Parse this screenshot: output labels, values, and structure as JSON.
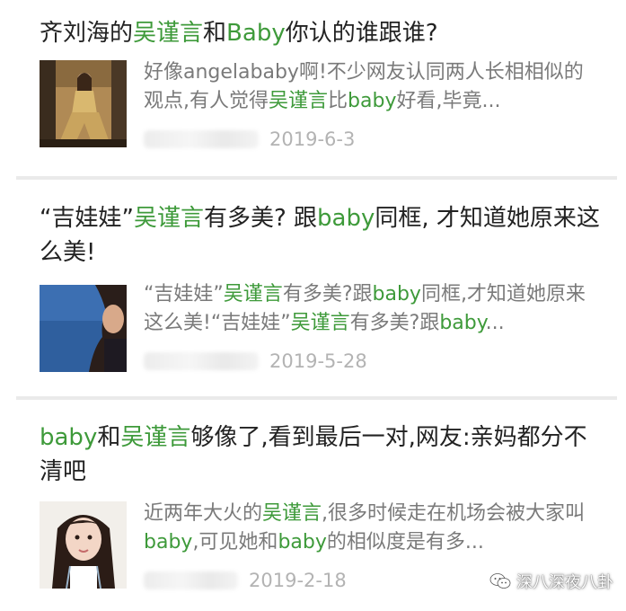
{
  "articles": [
    {
      "title": [
        {
          "t": "齐刘海的",
          "h": false
        },
        {
          "t": "吴谨言",
          "h": true
        },
        {
          "t": "和",
          "h": false
        },
        {
          "t": "Baby",
          "h": true
        },
        {
          "t": "你认的谁跟谁?",
          "h": false
        }
      ],
      "snippet": [
        {
          "t": "好像angelababy啊!不少网友认同两人长相相似的观点,有人觉得",
          "h": false
        },
        {
          "t": "吴谨言",
          "h": true
        },
        {
          "t": "比",
          "h": false
        },
        {
          "t": "baby",
          "h": true
        },
        {
          "t": "好看,毕竟...",
          "h": false
        }
      ],
      "date": "2019-6-3",
      "thumb_icon": "woman-sitting-photo"
    },
    {
      "title": [
        {
          "t": "“吉娃娃”",
          "h": false
        },
        {
          "t": "吴谨言",
          "h": true
        },
        {
          "t": "有多美? 跟",
          "h": false
        },
        {
          "t": "baby",
          "h": true
        },
        {
          "t": "同框, 才知道她原来这么美!",
          "h": false
        }
      ],
      "snippet": [
        {
          "t": "“吉娃娃”",
          "h": false
        },
        {
          "t": "吴谨言",
          "h": true
        },
        {
          "t": "有多美?跟",
          "h": false
        },
        {
          "t": "baby",
          "h": true
        },
        {
          "t": "同框,才知道她原来这么美!“吉娃娃”",
          "h": false
        },
        {
          "t": "吴谨言",
          "h": true
        },
        {
          "t": "有多美?跟",
          "h": false
        },
        {
          "t": "baby",
          "h": true
        },
        {
          "t": "...",
          "h": false
        }
      ],
      "date": "2019-5-28",
      "thumb_icon": "man-portrait-photo"
    },
    {
      "title": [
        {
          "t": "baby",
          "h": true
        },
        {
          "t": "和",
          "h": false
        },
        {
          "t": "吴谨言",
          "h": true
        },
        {
          "t": "够像了,看到最后一对,网友:亲妈都分不清吧",
          "h": false
        }
      ],
      "snippet": [
        {
          "t": "近两年大火的",
          "h": false
        },
        {
          "t": "吴谨言",
          "h": true
        },
        {
          "t": ",很多时候走在机场会被大家叫",
          "h": false
        },
        {
          "t": "baby",
          "h": true
        },
        {
          "t": ",可见她和",
          "h": false
        },
        {
          "t": "baby",
          "h": true
        },
        {
          "t": "的相似度是有多...",
          "h": false
        }
      ],
      "date": "2019-2-18",
      "thumb_icon": "girl-portrait-photo"
    }
  ],
  "colors": {
    "highlight": "#3e9a3a",
    "text": "#222222",
    "snippet": "#7a7a7a",
    "date": "#b3b3b3"
  },
  "watermark": {
    "label": "深八深夜八卦",
    "icon": "wechat-icon"
  }
}
